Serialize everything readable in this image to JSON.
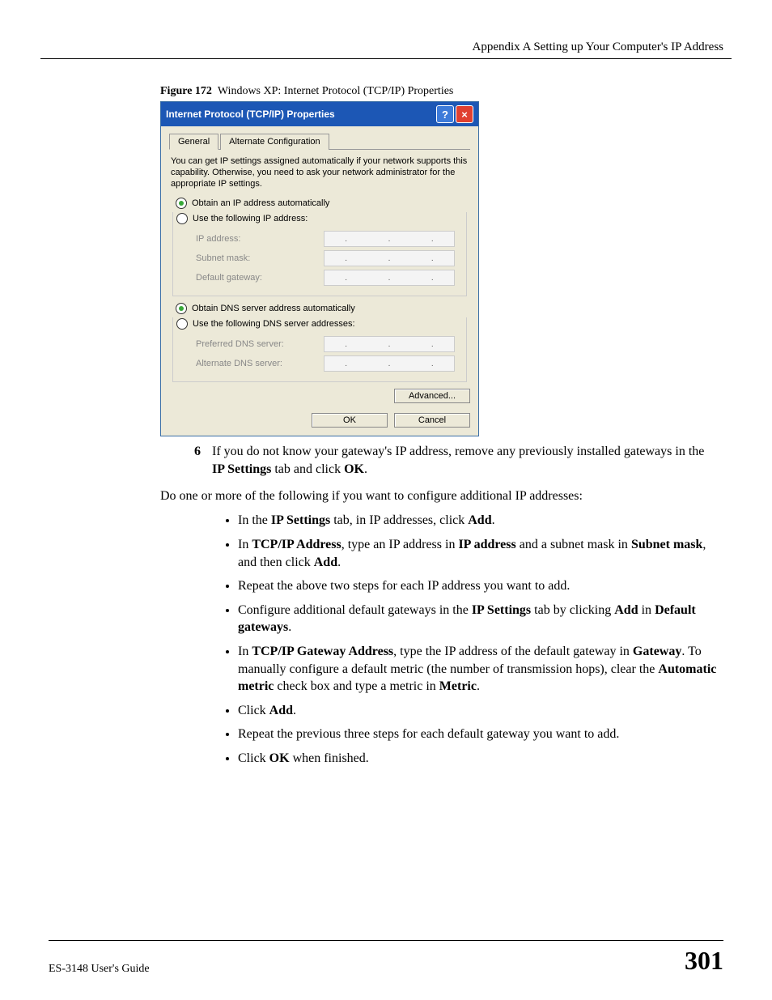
{
  "header": {
    "appendix": "Appendix A Setting up Your Computer's IP Address"
  },
  "figure": {
    "label": "Figure 172",
    "title": "Windows XP: Internet Protocol (TCP/IP) Properties"
  },
  "dialog": {
    "title": "Internet Protocol (TCP/IP) Properties",
    "tabs": {
      "general": "General",
      "alternate": "Alternate Configuration"
    },
    "explain": "You can get IP settings assigned automatically if your network supports this capability. Otherwise, you need to ask your network administrator for the appropriate IP settings.",
    "radio_ip_auto": "Obtain an IP address automatically",
    "radio_ip_manual": "Use the following IP address:",
    "fields": {
      "ip": "IP address:",
      "subnet": "Subnet mask:",
      "gateway": "Default gateway:"
    },
    "radio_dns_auto": "Obtain DNS server address automatically",
    "radio_dns_manual": "Use the following DNS server addresses:",
    "dns_fields": {
      "preferred": "Preferred DNS server:",
      "alternate": "Alternate DNS server:"
    },
    "buttons": {
      "advanced": "Advanced...",
      "ok": "OK",
      "cancel": "Cancel"
    }
  },
  "step6": {
    "num": "6",
    "pre": "If you do not know your gateway's IP address, remove any previously installed gateways in the ",
    "b1": "IP Settings",
    "mid": " tab and click ",
    "b2": "OK",
    "post": "."
  },
  "para1": "Do one or more of the following if you want to configure additional IP addresses:",
  "bullets": [
    {
      "parts": [
        "In the ",
        {
          "b": "IP Settings"
        },
        " tab, in IP addresses, click ",
        {
          "b": "Add"
        },
        "."
      ]
    },
    {
      "parts": [
        "In ",
        {
          "b": "TCP/IP Address"
        },
        ", type an IP address in ",
        {
          "b": "IP address"
        },
        " and a subnet mask in ",
        {
          "b": "Subnet mask"
        },
        ", and then click ",
        {
          "b": "Add"
        },
        "."
      ]
    },
    {
      "parts": [
        "Repeat the above two steps for each IP address you want to add."
      ]
    },
    {
      "parts": [
        "Configure additional default gateways in the ",
        {
          "b": "IP Settings"
        },
        " tab by clicking ",
        {
          "b": "Add"
        },
        " in ",
        {
          "b": "Default gateways"
        },
        "."
      ]
    },
    {
      "parts": [
        "In ",
        {
          "b": "TCP/IP Gateway Address"
        },
        ", type the IP address of the default gateway in ",
        {
          "b": "Gateway"
        },
        ". To manually configure a default metric (the number of transmission hops), clear the ",
        {
          "b": "Automatic metric"
        },
        " check box and type a metric in ",
        {
          "b": "Metric"
        },
        "."
      ]
    },
    {
      "parts": [
        "Click ",
        {
          "b": "Add"
        },
        "."
      ]
    },
    {
      "parts": [
        "Repeat the previous three steps for each default gateway you want to add."
      ]
    },
    {
      "parts": [
        "Click ",
        {
          "b": "OK"
        },
        " when finished."
      ]
    }
  ],
  "footer": {
    "guide": "ES-3148 User's Guide",
    "page": "301"
  }
}
